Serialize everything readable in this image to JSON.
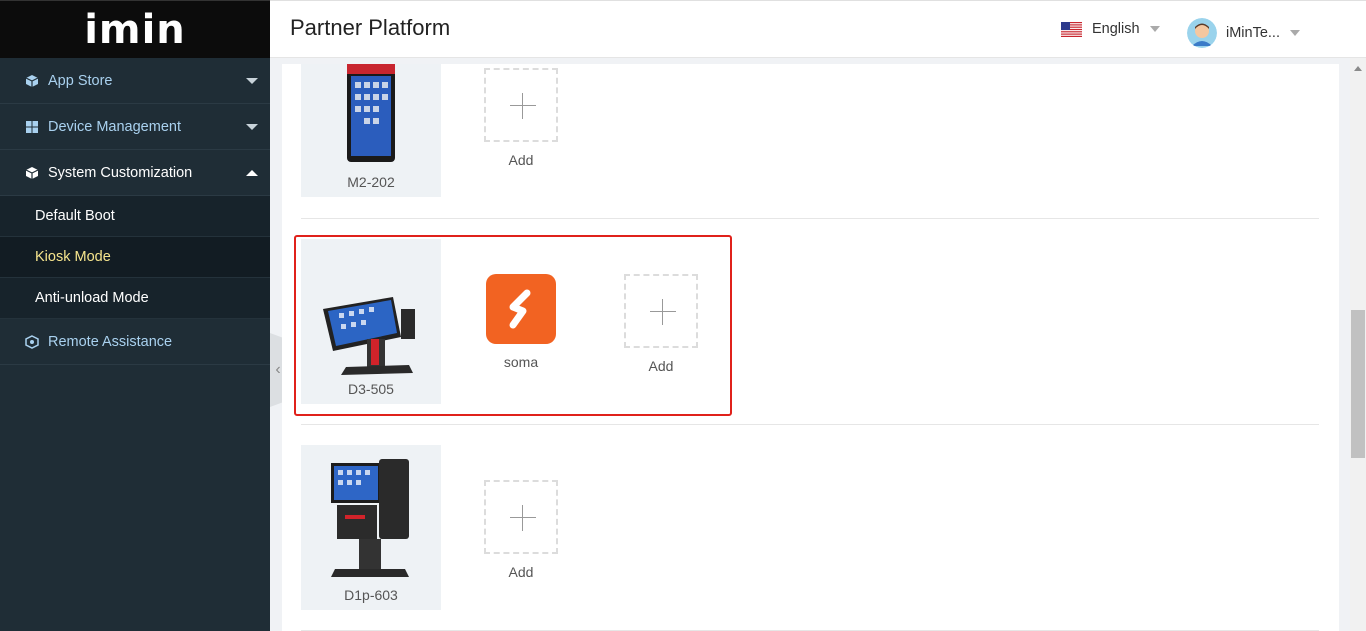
{
  "app": {
    "logo": "imin",
    "title": "Partner Platform"
  },
  "header": {
    "language": "English",
    "user_name": "iMinTe..."
  },
  "sidebar": {
    "items": [
      {
        "label": "App Store",
        "icon": "cube-icon"
      },
      {
        "label": "Device Management",
        "icon": "grid-icon"
      },
      {
        "label": "System Customization",
        "icon": "cube-icon"
      },
      {
        "label": "Remote Assistance",
        "icon": "settings-cube-icon"
      }
    ],
    "submenu": [
      {
        "label": "Default Boot"
      },
      {
        "label": "Kiosk Mode"
      },
      {
        "label": "Anti-unload Mode"
      }
    ]
  },
  "devices": [
    {
      "name": "M2-202",
      "add_label": "Add"
    },
    {
      "name": "D3-505",
      "app_name": "soma",
      "add_label": "Add"
    },
    {
      "name": "D1p-603",
      "add_label": "Add"
    }
  ],
  "colors": {
    "sidebar_bg": "#1f2d36",
    "highlight": "#e0211b",
    "active_submenu": "#f6e58d",
    "app_icon": "#f26322"
  }
}
